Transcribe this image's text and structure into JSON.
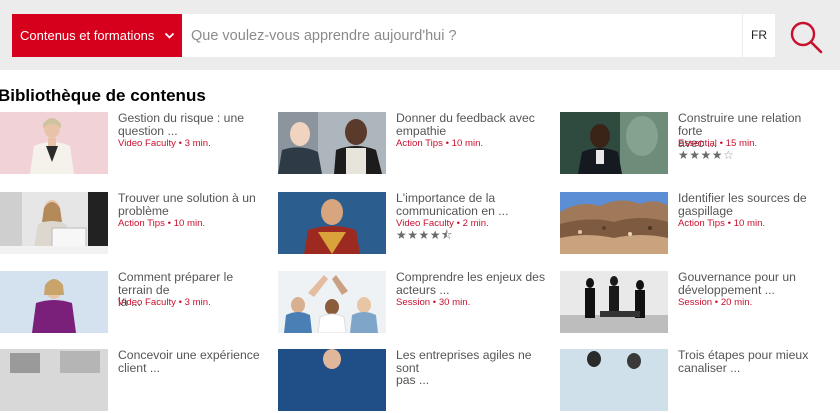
{
  "header": {
    "category_button_label": "Contenus et formations",
    "search_placeholder": "Que voulez-vous apprendre aujourd'hui ?",
    "language": "FR",
    "accent_color": "#d6001c"
  },
  "section": {
    "title": "Bibliothèque de contenus"
  },
  "cards": [
    {
      "title_line1": "Gestion du risque : une",
      "title_line2": "question ...",
      "meta": "Video Faculty • 3 min.",
      "thumbnail": "woman-speaker-pink-background"
    },
    {
      "title_line1": "Donner du feedback avec",
      "title_line2": "empathie",
      "meta": "Action Tips • 10 min.",
      "thumbnail": "two-men-conversation"
    },
    {
      "title_line1": "Construire une relation forte",
      "title_line2": "avec ...",
      "meta": "Essential • 15 min.",
      "thumbnail": "man-speaking-on-stage",
      "rating": {
        "value": 4,
        "max": 5
      }
    },
    {
      "title_line1": "Trouver une solution à un",
      "title_line2": "problème",
      "meta": "Action Tips • 10 min.",
      "thumbnail": "woman-at-laptop-office"
    },
    {
      "title_line1": "L'importance de la",
      "title_line2": "communication en ...",
      "meta": "Video Faculty • 2 min.",
      "thumbnail": "monk-blue-background",
      "rating": {
        "value": 4.5,
        "max": 5
      }
    },
    {
      "title_line1": "Identifier les sources de",
      "title_line2": "gaspillage",
      "meta": "Action Tips • 10 min.",
      "thumbnail": "pile-of-waste-sky"
    },
    {
      "title_line1": "Comment préparer le terrain de",
      "title_line2": "la ...",
      "meta": "Video Faculty • 3 min.",
      "thumbnail": "woman-speaker-purple-dress"
    },
    {
      "title_line1": "Comprendre les enjeux des",
      "title_line2": "acteurs ...",
      "meta": "Session • 30 min.",
      "thumbnail": "team-high-five"
    },
    {
      "title_line1": "Gouvernance pour un",
      "title_line2": "développement ...",
      "meta": "Session • 20 min.",
      "thumbnail": "business-silhouettes-window"
    },
    {
      "title_line1": "Concevoir une expérience",
      "title_line2": "client ...",
      "meta": "",
      "thumbnail": "store-interior"
    },
    {
      "title_line1": "Les entreprises agiles ne sont",
      "title_line2": "pas ...",
      "meta": "",
      "thumbnail": "man-blue-background"
    },
    {
      "title_line1": "Trois étapes pour mieux",
      "title_line2": "canaliser ...",
      "meta": "",
      "thumbnail": "people-silhouettes-office"
    }
  ]
}
